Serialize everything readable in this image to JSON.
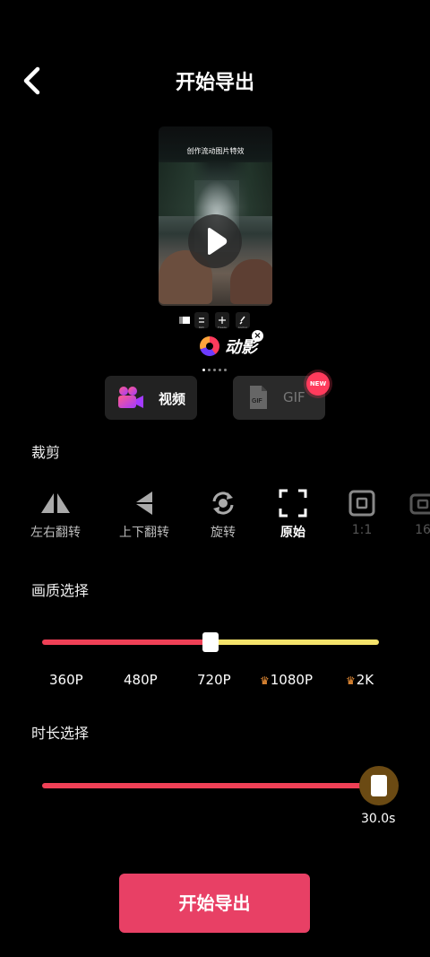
{
  "header": {
    "title": "开始导出"
  },
  "preview": {
    "caption": "创作流动图片特效",
    "tools": [
      "Path",
      "Freeze",
      "Anchor"
    ]
  },
  "brand": {
    "name": "动影"
  },
  "formats": {
    "video_label": "视频",
    "gif_label": "GIF",
    "new_badge": "NEW",
    "selected": "视频"
  },
  "crop": {
    "section_title": "裁剪",
    "options": [
      {
        "label": "左右翻转",
        "icon": "flip-horizontal-icon"
      },
      {
        "label": "上下翻转",
        "icon": "flip-vertical-icon"
      },
      {
        "label": "旋转",
        "icon": "rotate-icon"
      },
      {
        "label": "原始",
        "icon": "crop-original-icon",
        "selected": true
      },
      {
        "label": "1:1",
        "icon": "ratio-square-icon"
      },
      {
        "label": "16",
        "icon": "ratio-wide-icon"
      }
    ]
  },
  "quality": {
    "section_title": "画质选择",
    "options": [
      "360P",
      "480P",
      "720P",
      "1080P",
      "2K"
    ],
    "premium": [
      "1080P",
      "2K"
    ],
    "selected": "720P",
    "selected_fraction": 0.5
  },
  "duration": {
    "section_title": "时长选择",
    "value_label": "30.0s",
    "fraction": 1.0
  },
  "colors": {
    "accent": "#e84065",
    "track_active": "#ef4056",
    "track_inactive": "#f5e36b",
    "crown": "#ff9b3b"
  },
  "export_button": {
    "label": "开始导出"
  }
}
